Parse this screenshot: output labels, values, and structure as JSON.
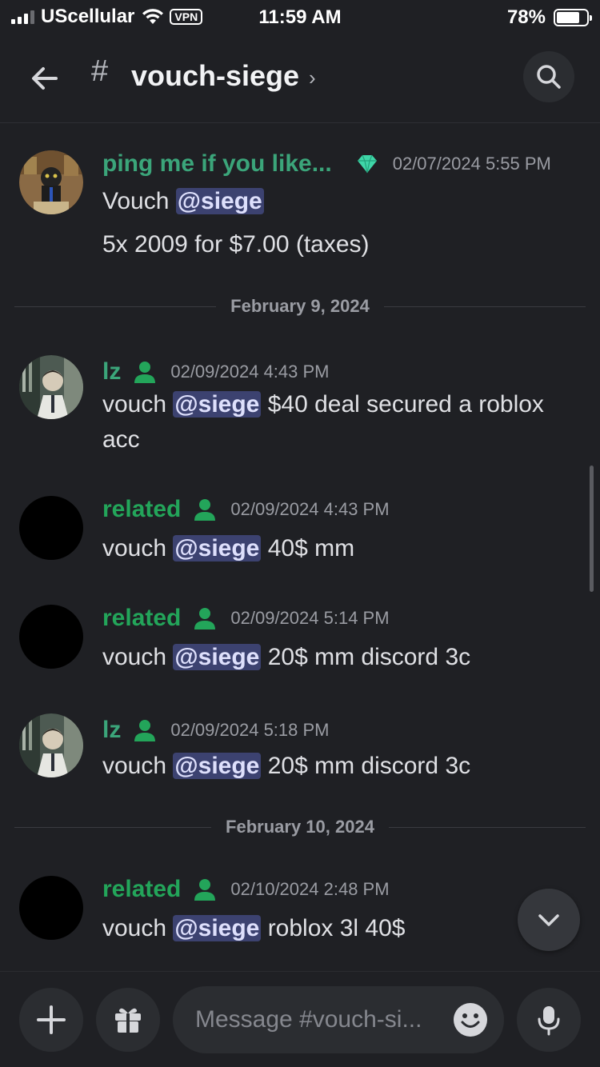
{
  "status_bar": {
    "carrier": "UScellular",
    "vpn": "VPN",
    "time": "11:59 AM",
    "battery": "78%",
    "battery_level": 0.78
  },
  "header": {
    "hash": "#",
    "channel": "vouch-siege",
    "chevron": "›"
  },
  "messages": [
    {
      "username": "ping me if you like...",
      "timestamp": "02/07/2024 5:55 PM",
      "lines": [
        {
          "pre": "Vouch ",
          "mention": "@siege",
          "post": ""
        },
        {
          "pre": "5x 2009 for $7.00 (taxes)",
          "mention": "",
          "post": ""
        }
      ]
    },
    {
      "username": "lz",
      "timestamp": "02/09/2024 4:43 PM",
      "pre": "vouch ",
      "mention": "@siege",
      "post": " $40 deal secured a roblox acc"
    },
    {
      "username": "related",
      "timestamp": "02/09/2024 4:43 PM",
      "pre": "vouch ",
      "mention": "@siege",
      "post": " 40$ mm"
    },
    {
      "username": "related",
      "timestamp": "02/09/2024 5:14 PM",
      "pre": "vouch ",
      "mention": "@siege",
      "post": " 20$ mm discord 3c"
    },
    {
      "username": "lz",
      "timestamp": "02/09/2024 5:18 PM",
      "pre": "vouch ",
      "mention": "@siege",
      "post": " 20$ mm discord 3c"
    },
    {
      "username": "related",
      "timestamp": "02/10/2024 2:48 PM",
      "pre": "vouch ",
      "mention": "@siege",
      "post": " roblox  3l 40$"
    }
  ],
  "dividers": [
    "February 9, 2024",
    "February 10, 2024"
  ],
  "composer": {
    "placeholder": "Message #vouch-si..."
  },
  "icons": {
    "back": "arrow-left-icon",
    "search": "search-icon",
    "gem": "diamond-icon",
    "member": "member-icon",
    "jump": "chevron-down-icon",
    "plus": "plus-icon",
    "gift": "gift-icon",
    "emoji": "emoji-icon",
    "mic": "microphone-icon"
  },
  "colors": {
    "background": "#1f2024",
    "username": "#3ba57a",
    "mention_bg": "#3c4270",
    "gem": "#3fd6a8"
  }
}
